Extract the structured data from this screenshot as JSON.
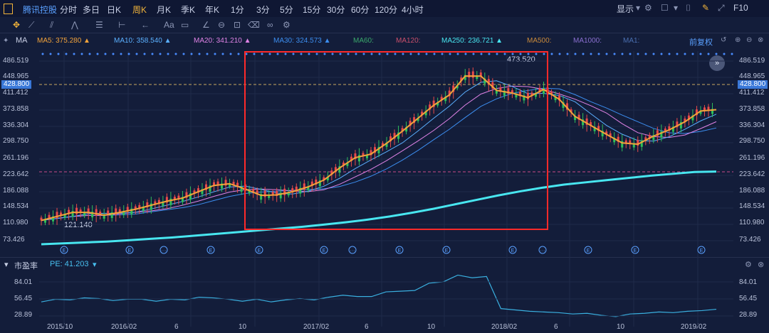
{
  "header": {
    "stock_name": "腾讯控股",
    "tabs": [
      "分时",
      "多日",
      "日K",
      "周K",
      "月K",
      "季K",
      "年K",
      "1分",
      "3分",
      "5分",
      "15分",
      "30分",
      "60分",
      "120分",
      "4小时"
    ],
    "active_tab": "周K",
    "display_label": "显示",
    "fullscreen_label": "F10"
  },
  "toolbar": {
    "icons": [
      "crosshair-icon",
      "line-icon",
      "channel-icon",
      "wave-icon",
      "fib-icon",
      "range-icon",
      "arrow-icon",
      "text-icon",
      "comment-icon",
      "angle-icon",
      "measure-icon",
      "lock-icon",
      "eye-icon",
      "trash-icon",
      "link-icon",
      "settings-icon"
    ],
    "text_tool": "Aa"
  },
  "main_indicator": {
    "label": "MA",
    "ma": [
      {
        "label": "MA5: 375.280",
        "color": "#f2a33b",
        "arrow": "▲"
      },
      {
        "label": "MA10: 358.540",
        "color": "#5bb0ff",
        "arrow": "▲"
      },
      {
        "label": "MA20: 341.210",
        "color": "#e083e6",
        "arrow": "▲"
      },
      {
        "label": "MA30: 324.573",
        "color": "#3c8ef0",
        "arrow": "▲"
      },
      {
        "label": "MA60:",
        "color": "#3aa86b",
        "arrow": ""
      },
      {
        "label": "MA120:",
        "color": "#c94f6b",
        "arrow": ""
      },
      {
        "label": "MA250: 236.721",
        "color": "#48e6f0",
        "arrow": "▲"
      },
      {
        "label": "MA500:",
        "color": "#c98a3b",
        "arrow": ""
      },
      {
        "label": "MA1000:",
        "color": "#8a6fd0",
        "arrow": ""
      },
      {
        "label": "MA1:",
        "color": "#4a6fb0",
        "arrow": ""
      }
    ],
    "restore_label": "前复权",
    "current_price": "428.800",
    "max_annotation": "473.520",
    "min_annotation": "121.140"
  },
  "y_axis": [
    "486.519",
    "448.965",
    "411.412",
    "373.858",
    "336.304",
    "298.750",
    "261.196",
    "223.642",
    "186.088",
    "148.534",
    "110.980",
    "73.426"
  ],
  "x_axis": [
    "2015/10",
    "2016/02",
    "6",
    "10",
    "2017/02",
    "6",
    "10",
    "2018/02",
    "6",
    "10",
    "2019/02"
  ],
  "pe_panel": {
    "title": "市盈率",
    "value_label": "PE: 41.203",
    "y_axis": [
      "84.01",
      "56.45",
      "28.89"
    ]
  },
  "chart_data": [
    {
      "type": "line",
      "title": "",
      "series": [
        {
          "name": "MA5",
          "values": [
            128,
            137,
            146,
            146,
            140,
            146,
            153,
            162,
            171,
            178,
            192,
            206,
            210,
            198,
            184,
            185,
            192,
            203,
            218,
            245,
            268,
            276,
            300,
            327,
            356,
            385,
            408,
            450,
            450,
            418,
            412,
            402,
            420,
            398,
            360,
            340,
            320,
            301,
            298,
            316,
            330,
            348,
            372,
            375
          ]
        },
        {
          "name": "MA250",
          "values": [
            75,
            77,
            79,
            81,
            84,
            87,
            90,
            94,
            98,
            102,
            106,
            110,
            114,
            119,
            124,
            130,
            137,
            145,
            154,
            164,
            174,
            184,
            193,
            201,
            208,
            213,
            218,
            223,
            228,
            232,
            236,
            237
          ]
        }
      ],
      "x": [
        "2015/10",
        "2016/02",
        "6",
        "10",
        "2017/02",
        "6",
        "10",
        "2018/02",
        "6",
        "10",
        "2019/02"
      ],
      "ylim": [
        73.426,
        486.519
      ],
      "xlabel": "",
      "ylabel": ""
    },
    {
      "type": "line",
      "title": "",
      "series": [
        {
          "name": "PE",
          "values": [
            52,
            56,
            55,
            58,
            57,
            54,
            56,
            56,
            53,
            56,
            55,
            59,
            58,
            56,
            53,
            56,
            52,
            55,
            57,
            55,
            59,
            62,
            60,
            60,
            67,
            68,
            69,
            80,
            82,
            92,
            88,
            90,
            42,
            40,
            38,
            37,
            36,
            34,
            35,
            32,
            30,
            34,
            35,
            37,
            36,
            38,
            39,
            41
          ]
        }
      ],
      "ylim": [
        28.89,
        84.01
      ]
    }
  ]
}
